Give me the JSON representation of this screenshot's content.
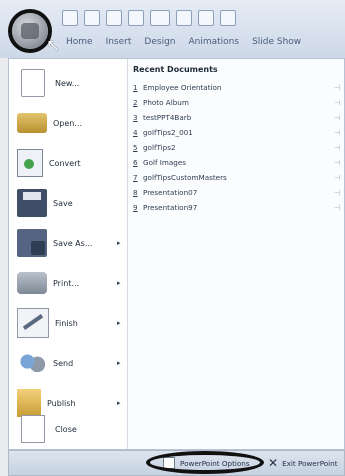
{
  "ribbon": {
    "tabs": [
      "Home",
      "Insert",
      "Design",
      "Animations",
      "Slide Show"
    ]
  },
  "menu": {
    "items": [
      {
        "label": "New...",
        "arrow": ""
      },
      {
        "label": "Open...",
        "arrow": ""
      },
      {
        "label": "Convert",
        "arrow": ""
      },
      {
        "label": "Save",
        "arrow": ""
      },
      {
        "label": "Save As...",
        "arrow": "▸"
      },
      {
        "label": "Print...",
        "arrow": "▸"
      },
      {
        "label": "Finish",
        "arrow": "▸"
      },
      {
        "label": "Send",
        "arrow": "▸"
      },
      {
        "label": "Publish",
        "arrow": "▸"
      },
      {
        "label": "Close",
        "arrow": ""
      }
    ],
    "recent": {
      "title": "Recent Documents",
      "items": [
        {
          "num": "1",
          "name": "Employee Orientation"
        },
        {
          "num": "2",
          "name": "Photo Album"
        },
        {
          "num": "3",
          "name": "testPPT4Barb"
        },
        {
          "num": "4",
          "name": "golfTips2_001"
        },
        {
          "num": "5",
          "name": "golfTips2"
        },
        {
          "num": "6",
          "name": "Golf Images"
        },
        {
          "num": "7",
          "name": "golfTipsCustomMasters"
        },
        {
          "num": "8",
          "name": "Presentation07"
        },
        {
          "num": "9",
          "name": "Presentation97"
        }
      ]
    }
  },
  "footer": {
    "options": "PowerPoint Options",
    "exit": "Exit PowerPoint"
  }
}
